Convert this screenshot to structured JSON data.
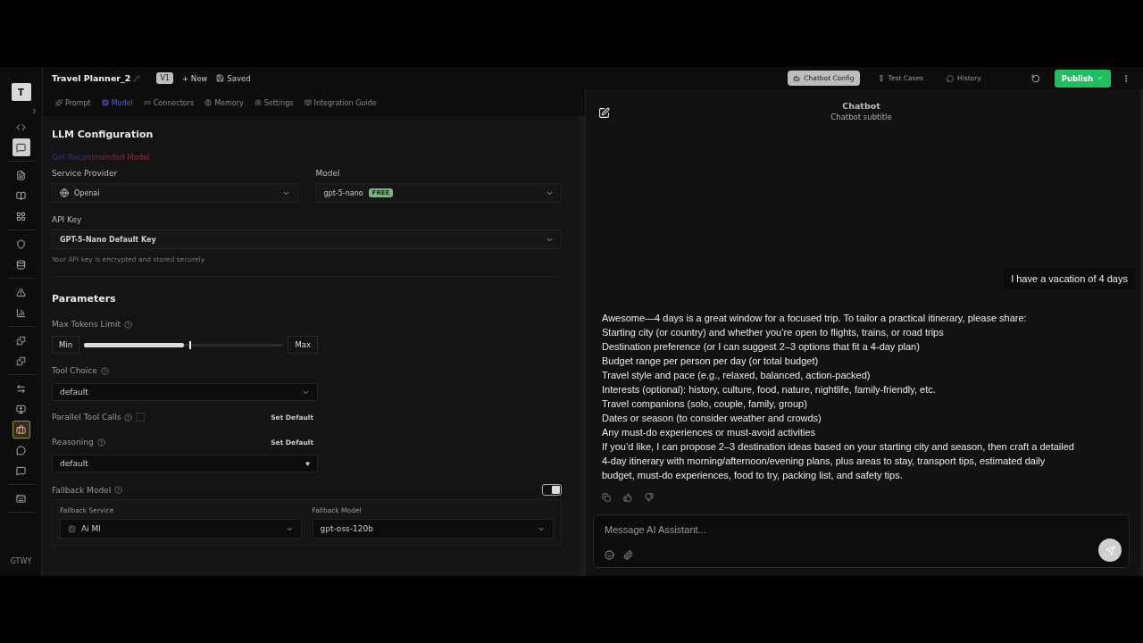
{
  "sidebar": {
    "avatar": "T",
    "groups": [
      {
        "items": [
          {
            "selected": false
          },
          {
            "selected": true
          }
        ]
      },
      {
        "items": [
          {
            "selected": false
          },
          {
            "selected": false
          },
          {
            "selected": false
          }
        ]
      },
      {
        "items": [
          {
            "selected": false
          },
          {
            "selected": false
          }
        ]
      },
      {
        "items": [
          {
            "selected": false
          },
          {
            "selected": false
          }
        ]
      },
      {
        "items": [
          {
            "selected": false
          },
          {
            "selected": false
          }
        ]
      },
      {
        "items": [
          {
            "selected": false
          },
          {
            "selected": false
          },
          {
            "selected": true
          },
          {
            "selected": false
          },
          {
            "selected": false
          }
        ]
      },
      {
        "items": [
          {
            "selected": false
          }
        ]
      }
    ],
    "brand": "GTWY"
  },
  "editor": {
    "title": "Travel Planner_2",
    "version": "V1",
    "new_label": "+ New",
    "saved_label": "Saved",
    "tabs": [
      {
        "label": "Prompt",
        "selected": false
      },
      {
        "label": "Model",
        "selected": true
      },
      {
        "label": "Connectors",
        "selected": false
      },
      {
        "label": "Memory",
        "selected": false
      },
      {
        "label": "Settings",
        "selected": false
      },
      {
        "label": "Integration Guide",
        "selected": false
      }
    ],
    "llm": {
      "heading": "LLM Configuration",
      "recommend_link": "Get Recommended Model",
      "service_provider": {
        "label": "Service Provider",
        "value": "Openai"
      },
      "model": {
        "label": "Model",
        "value": "gpt-5-nano",
        "badge": "FREE"
      },
      "api_key": {
        "label": "API Key",
        "value": "GPT-5-Nano Default Key",
        "hint": "Your API key is encrypted and stored securely"
      }
    },
    "parameters": {
      "heading": "Parameters",
      "max_tokens": {
        "label": "Max Tokens Limit",
        "min": "Min",
        "max": "Max",
        "level": 0.5
      },
      "tool_choice": {
        "label": "Tool Choice",
        "value": "default"
      },
      "parallel_tool_calls": {
        "label": "Parallel Tool Calls",
        "checked": false,
        "action": "Set Default"
      },
      "reasoning": {
        "label": "Reasoning",
        "action": "Set Default",
        "value": "default"
      },
      "fallback": {
        "label": "Fallback Model",
        "on": true,
        "service_label": "Fallback Service",
        "service_value": "Ai Ml",
        "model_label": "Fallback Model",
        "model_value": "gpt-oss-120b"
      }
    }
  },
  "chat": {
    "tabs": [
      {
        "label": "Chatbot Config",
        "selected": true
      },
      {
        "label": "Test Cases",
        "selected": false
      },
      {
        "label": "History",
        "selected": false
      }
    ],
    "publish": "Publish",
    "title": "Chatbot",
    "subtitle": "Chatbot subtitle",
    "messages": [
      {
        "kind": "user",
        "lines": [
          "I have a vacation of 4 days"
        ]
      },
      {
        "kind": "assistant",
        "lines": [
          "Awesome—4 days is a great window for a focused trip. To tailor a practical itinerary, please share:",
          "Starting city (or country) and whether you’re open to flights, trains, or road trips",
          "Destination preference (or I can suggest 2–3 options that fit a 4-day plan)",
          "Budget range per person per day (or total budget)",
          "Travel style and pace (e.g., relaxed, balanced, action-packed)",
          "Interests (optional): history, culture, food, nature, nightlife, family-friendly, etc.",
          "Travel companions (solo, couple, family, group)",
          "Dates or season (to consider weather and crowds)",
          "Any must-do experiences or must-avoid activities",
          "If you’d like, I can propose 2–3 destination ideas based on your starting city and season, then craft a detailed 4-day itinerary with morning/afternoon/evening plans, plus areas to stay, transport tips, estimated daily budget, must-do experiences, food to try, packing list, and safety tips."
        ]
      }
    ],
    "input": {
      "placeholder": "Message AI Assistant..."
    }
  }
}
